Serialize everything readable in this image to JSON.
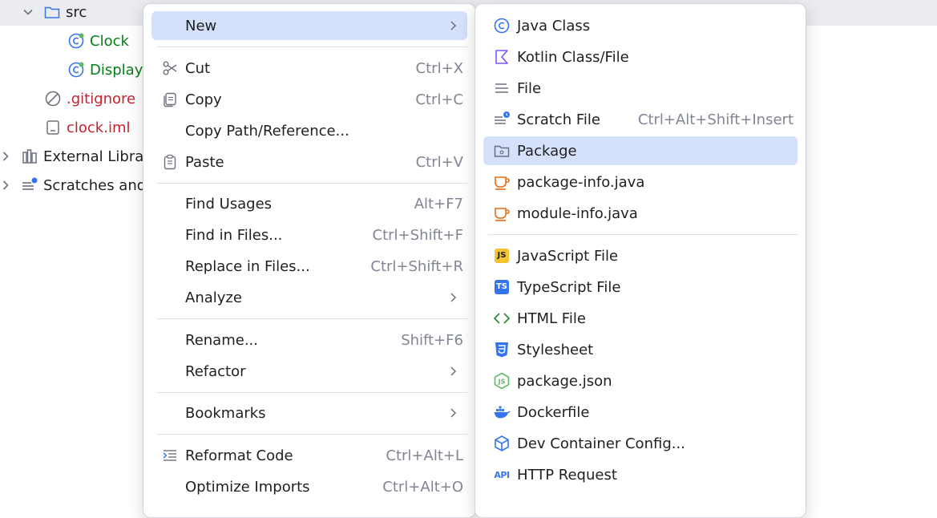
{
  "tree": {
    "items": [
      {
        "label": "src"
      },
      {
        "label": "Clock"
      },
      {
        "label": "Display"
      },
      {
        "label": ".gitignore"
      },
      {
        "label": "clock.iml"
      },
      {
        "label": "External Librar"
      },
      {
        "label": "Scratches and"
      }
    ]
  },
  "context_menu": {
    "items": [
      {
        "label": "New",
        "shortcut": "",
        "icon": "none",
        "submenu": true
      },
      {
        "label": "Cut",
        "shortcut": "Ctrl+X",
        "icon": "scissors-icon"
      },
      {
        "label": "Copy",
        "shortcut": "Ctrl+C",
        "icon": "copy-icon"
      },
      {
        "label": "Copy Path/Reference...",
        "shortcut": "",
        "icon": "none"
      },
      {
        "label": "Paste",
        "shortcut": "Ctrl+V",
        "icon": "paste-icon"
      },
      {
        "label": "Find Usages",
        "shortcut": "Alt+F7",
        "icon": "none"
      },
      {
        "label": "Find in Files...",
        "shortcut": "Ctrl+Shift+F",
        "icon": "none"
      },
      {
        "label": "Replace in Files...",
        "shortcut": "Ctrl+Shift+R",
        "icon": "none"
      },
      {
        "label": "Analyze",
        "shortcut": "",
        "icon": "none",
        "submenu": true
      },
      {
        "label": "Rename...",
        "shortcut": "Shift+F6",
        "icon": "none"
      },
      {
        "label": "Refactor",
        "shortcut": "",
        "icon": "none",
        "submenu": true
      },
      {
        "label": "Bookmarks",
        "shortcut": "",
        "icon": "none",
        "submenu": true
      },
      {
        "label": "Reformat Code",
        "shortcut": "Ctrl+Alt+L",
        "icon": "reformat-icon"
      },
      {
        "label": "Optimize Imports",
        "shortcut": "Ctrl+Alt+O",
        "icon": "none"
      }
    ]
  },
  "new_submenu": {
    "items": [
      {
        "label": "Java Class",
        "shortcut": "",
        "icon": "java-class-icon"
      },
      {
        "label": "Kotlin Class/File",
        "shortcut": "",
        "icon": "kotlin-icon"
      },
      {
        "label": "File",
        "shortcut": "",
        "icon": "file-icon"
      },
      {
        "label": "Scratch File",
        "shortcut": "Ctrl+Alt+Shift+Insert",
        "icon": "scratch-file-icon"
      },
      {
        "label": "Package",
        "shortcut": "",
        "icon": "package-icon"
      },
      {
        "label": "package-info.java",
        "shortcut": "",
        "icon": "java-cup-icon"
      },
      {
        "label": "module-info.java",
        "shortcut": "",
        "icon": "java-cup-icon"
      },
      {
        "label": "JavaScript File",
        "shortcut": "",
        "icon": "javascript-icon",
        "badge": "JS"
      },
      {
        "label": "TypeScript File",
        "shortcut": "",
        "icon": "typescript-icon",
        "badge": "TS"
      },
      {
        "label": "HTML File",
        "shortcut": "",
        "icon": "html-icon"
      },
      {
        "label": "Stylesheet",
        "shortcut": "",
        "icon": "css-icon"
      },
      {
        "label": "package.json",
        "shortcut": "",
        "icon": "nodejs-icon"
      },
      {
        "label": "Dockerfile",
        "shortcut": "",
        "icon": "docker-icon"
      },
      {
        "label": "Dev Container Config...",
        "shortcut": "",
        "icon": "dev-container-icon"
      },
      {
        "label": "HTTP Request",
        "shortcut": "",
        "icon": "api-icon",
        "badge": "API"
      }
    ]
  },
  "colors": {
    "selection": "#d5e0fa",
    "java_green": "#067d17",
    "ignored_red": "#c7222d",
    "shortcut_gray": "#818594",
    "icon_blue": "#3574f0",
    "java_orange": "#e56d17"
  }
}
